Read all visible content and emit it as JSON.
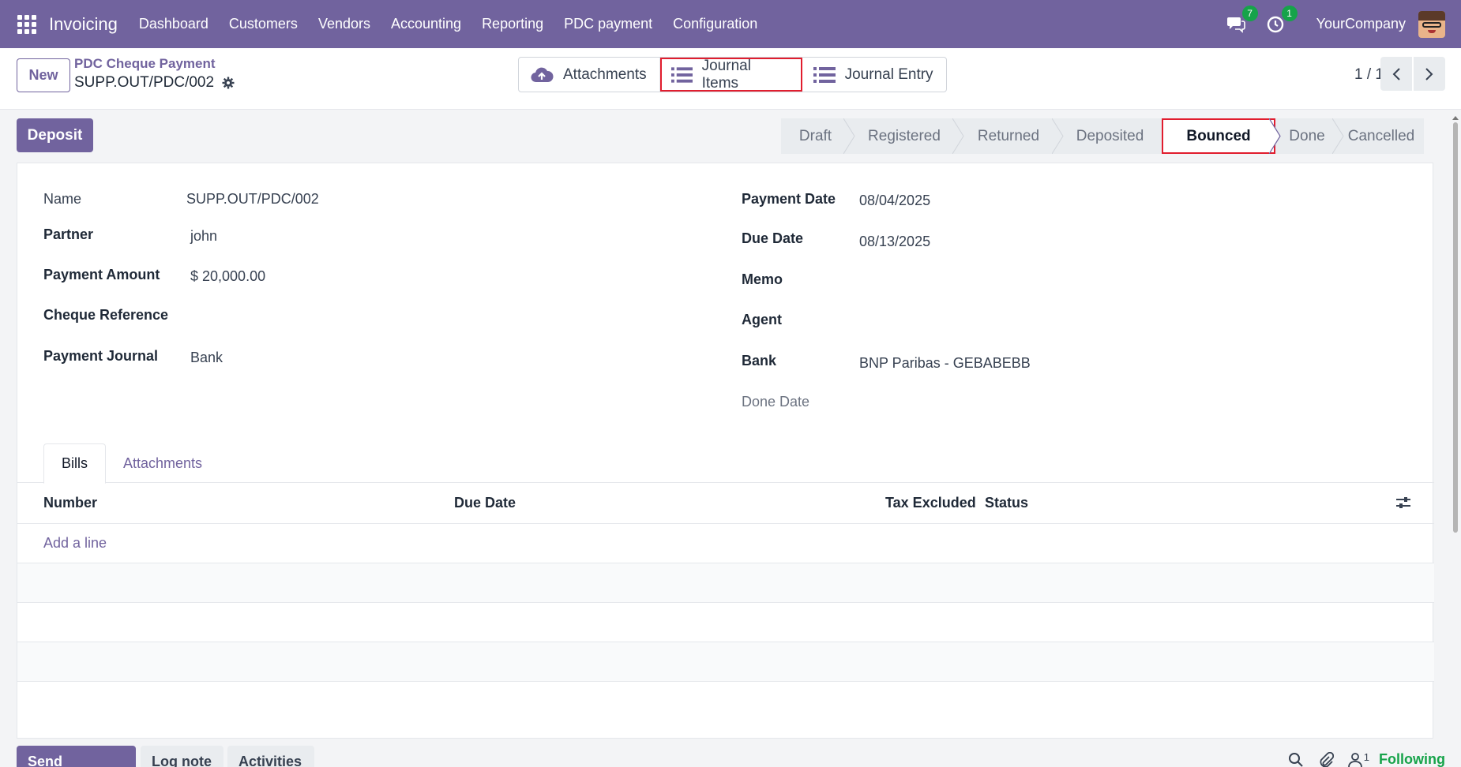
{
  "navbar": {
    "app_name": "Invoicing",
    "menu": [
      "Dashboard",
      "Customers",
      "Vendors",
      "Accounting",
      "Reporting",
      "PDC payment",
      "Configuration"
    ],
    "messages_count": "7",
    "activities_count": "1",
    "company": "YourCompany",
    "bg_color": "#71639e"
  },
  "control": {
    "new_label": "New",
    "breadcrumb": "PDC Cheque Payment",
    "record_name": "SUPP.OUT/PDC/002",
    "smart_buttons": [
      "Attachments",
      "Journal Items",
      "Journal Entry"
    ],
    "pager": "1 / 1"
  },
  "actions": {
    "deposit_label": "Deposit"
  },
  "statusbar": {
    "stages": [
      "Draft",
      "Registered",
      "Returned",
      "Deposited",
      "Bounced",
      "Done",
      "Cancelled"
    ],
    "active": "Bounced"
  },
  "form": {
    "left": {
      "name_label": "Name",
      "name_value": "SUPP.OUT/PDC/002",
      "partner_label": "Partner",
      "partner_value": "john",
      "amount_label": "Payment Amount",
      "amount_value": "$ 20,000.00",
      "cheque_ref_label": "Cheque Reference",
      "journal_label": "Payment Journal",
      "journal_value": "Bank"
    },
    "right": {
      "payment_date_label": "Payment Date",
      "payment_date_value": "08/04/2025",
      "due_date_label": "Due Date",
      "due_date_value": "08/13/2025",
      "memo_label": "Memo",
      "agent_label": "Agent",
      "bank_label": "Bank",
      "bank_value": "BNP Paribas - GEBABEBB",
      "done_date_label": "Done Date"
    }
  },
  "tabs": [
    "Bills",
    "Attachments"
  ],
  "bills_table": {
    "columns": [
      "Number",
      "Due Date",
      "Tax Excluded",
      "Status"
    ],
    "add_line": "Add a line"
  },
  "chatter": {
    "send_message": "Send message",
    "log_note": "Log note",
    "activities": "Activities",
    "followers_count": "1",
    "following": "Following"
  }
}
